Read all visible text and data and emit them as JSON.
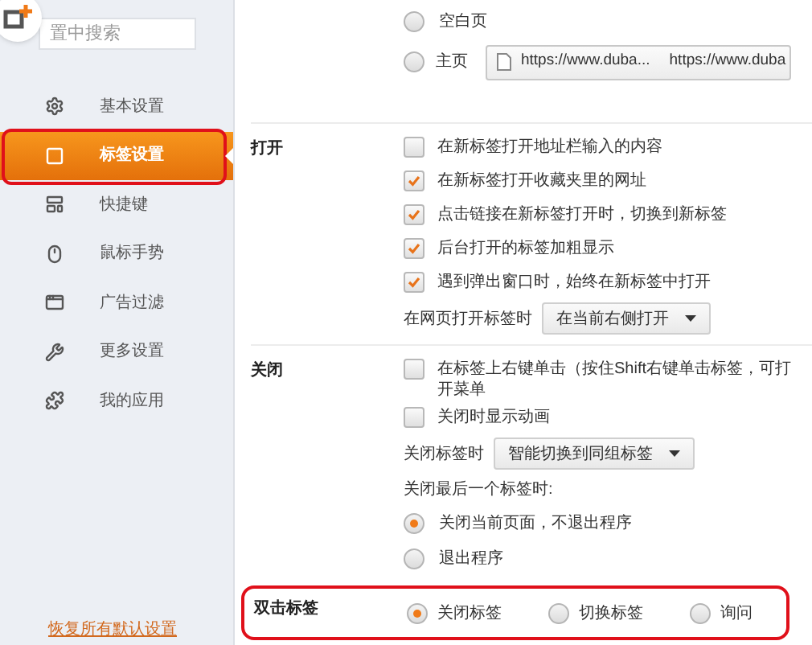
{
  "search": {
    "placeholder": "置中搜索"
  },
  "sidebar": {
    "items": [
      {
        "label": "基本设置",
        "selected": false
      },
      {
        "label": "标签设置",
        "selected": true
      },
      {
        "label": "快捷键",
        "selected": false
      },
      {
        "label": "鼠标手势",
        "selected": false
      },
      {
        "label": "广告过滤",
        "selected": false
      },
      {
        "label": "更多设置",
        "selected": false
      },
      {
        "label": "我的应用",
        "selected": false
      }
    ],
    "footer_link": "恢复所有默认设置"
  },
  "sections": [
    {
      "highlighted": false,
      "items": [
        {
          "kind": "radio",
          "label": "空白页",
          "selected": false
        },
        {
          "kind": "radio_url",
          "label": "主页",
          "selected": false,
          "urls": [
            "https://www.duba...",
            "https://www.duba"
          ]
        }
      ]
    },
    {
      "title": "打开",
      "highlighted": false,
      "items": [
        {
          "kind": "checkbox",
          "label": "在新标签打开地址栏输入的内容",
          "checked": false
        },
        {
          "kind": "checkbox",
          "label": "在新标签打开收藏夹里的网址",
          "checked": true
        },
        {
          "kind": "checkbox",
          "label": "点击链接在新标签打开时，切换到新标签",
          "checked": true
        },
        {
          "kind": "checkbox",
          "label": "后台打开的标签加粗显示",
          "checked": true
        },
        {
          "kind": "checkbox",
          "label": "遇到弹出窗口时，始终在新标签中打开",
          "checked": true
        },
        {
          "kind": "select",
          "label": "在网页打开标签时",
          "value": "在当前右侧打开"
        }
      ]
    },
    {
      "title": "关闭",
      "highlighted": false,
      "items": [
        {
          "kind": "checkbox",
          "label": "在标签上右键单击（按住Shift右键单击标签，可打开菜单",
          "checked": false
        },
        {
          "kind": "checkbox",
          "label": "关闭时显示动画",
          "checked": false
        },
        {
          "kind": "select",
          "label": "关闭标签时",
          "value": "智能切换到同组标签"
        },
        {
          "kind": "text",
          "label": "关闭最后一个标签时:"
        },
        {
          "kind": "radio",
          "label": "关闭当前页面，不退出程序",
          "selected": true
        },
        {
          "kind": "radio",
          "label": "退出程序",
          "selected": false
        }
      ]
    },
    {
      "title": "双击标签",
      "highlighted": true,
      "items": [
        {
          "kind": "radio_row",
          "options": [
            {
              "label": "关闭标签",
              "selected": true
            },
            {
              "label": "切换标签",
              "selected": false
            },
            {
              "label": "询问",
              "selected": false
            }
          ]
        }
      ]
    }
  ]
}
